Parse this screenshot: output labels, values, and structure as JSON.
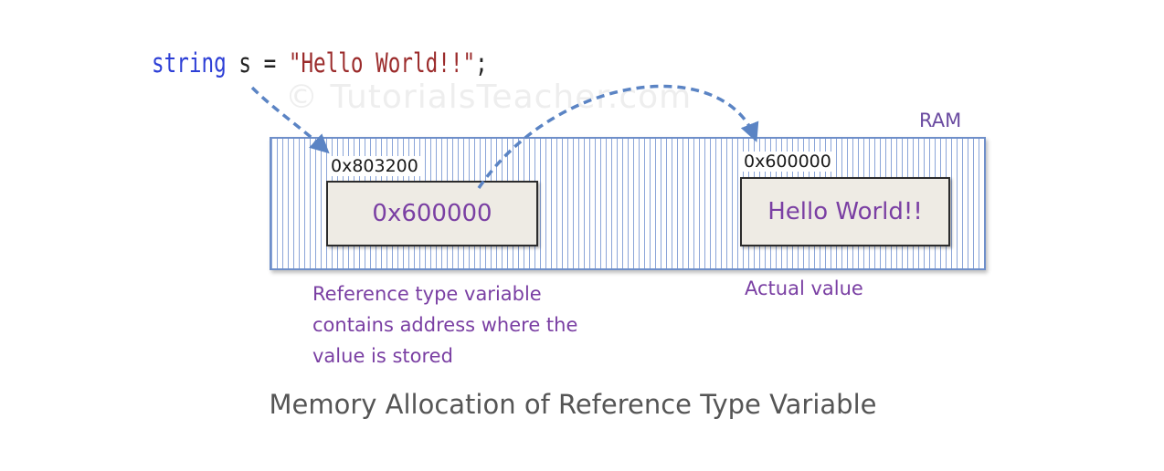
{
  "code": {
    "keyword": "string",
    "rest": " s = ",
    "string_literal": "\"Hello World!!\"",
    "terminator": ";"
  },
  "watermark": "© TutorialsTeacher.com",
  "ram": {
    "label": "RAM"
  },
  "reference_cell": {
    "address": "0x803200",
    "value": "0x600000",
    "note_lines": [
      "Reference type variable",
      "contains address where the",
      "value is stored"
    ]
  },
  "value_cell": {
    "address": "0x600000",
    "value": "Hello World!!",
    "note": "Actual value"
  },
  "caption": "Memory Allocation of Reference Type Variable",
  "colors": {
    "keyword": "#2d3fd6",
    "string_literal": "#9b2b2b",
    "accent_text": "#7a3fa3",
    "ram_lines": "#8ba5d8",
    "arrow": "#5b84c4"
  }
}
